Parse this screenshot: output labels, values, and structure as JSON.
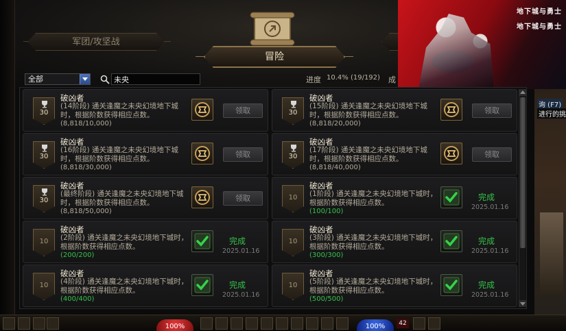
{
  "tabs": {
    "legion_label": "军团/攻坚战",
    "adventure_label": "冒险"
  },
  "filter": {
    "category_selected": "全部",
    "search_value": "未央"
  },
  "progress": {
    "label": "进度",
    "value": "10.4% (19/192)",
    "cut_label": "成"
  },
  "banner": {
    "logo_top": "地下城与勇士",
    "logo_bottom": "地下城与勇士"
  },
  "achievements": [
    {
      "title": "破凶者",
      "desc": "(14阶段) 通关逢魔之未央幻境地下城时，根据阶数获得相应点数。",
      "progress": "(8,818/10,000)",
      "points": "30",
      "status": "claim",
      "claim_label": "领取"
    },
    {
      "title": "破凶者",
      "desc": "(15阶段) 通关逢魔之未央幻境地下城时，根据阶数获得相应点数。",
      "progress": "(8,818/20,000)",
      "points": "30",
      "status": "claim",
      "claim_label": "领取"
    },
    {
      "title": "破凶者",
      "desc": "(16阶段) 通关逢魔之未央幻境地下城时，根据阶数获得相应点数。",
      "progress": "(8,818/30,000)",
      "points": "30",
      "status": "claim",
      "claim_label": "领取"
    },
    {
      "title": "破凶者",
      "desc": "(17阶段) 通关逢魔之未央幻境地下城时，根据阶数获得相应点数。",
      "progress": "(8,818/40,000)",
      "points": "30",
      "status": "claim",
      "claim_label": "领取"
    },
    {
      "title": "破凶者",
      "desc": "(最终阶段) 通关逢魔之未央幻境地下城时，根据阶数获得相应点数。",
      "progress": "(8,818/50,000)",
      "points": "30",
      "status": "claim",
      "claim_label": "领取"
    },
    {
      "title": "破凶者",
      "desc": "(1阶段) 通关逢魔之未央幻境地下城时，根据阶数获得相应点数。",
      "progress": "(100/100)",
      "points": "10",
      "status": "done",
      "done_label": "完成",
      "date": "2025.01.16"
    },
    {
      "title": "破凶者",
      "desc": "(2阶段) 通关逢魔之未央幻境地下城时，根据阶数获得相应点数。",
      "progress": "(200/200)",
      "points": "10",
      "status": "done",
      "done_label": "完成",
      "date": "2025.01.16"
    },
    {
      "title": "破凶者",
      "desc": "(3阶段) 通关逢魔之未央幻境地下城时，根据阶数获得相应点数。",
      "progress": "(300/300)",
      "points": "10",
      "status": "done",
      "done_label": "完成",
      "date": "2025.01.16"
    },
    {
      "title": "破凶者",
      "desc": "(4阶段) 通关逢魔之未央幻境地下城时，根据阶数获得相应点数。",
      "progress": "(400/400)",
      "points": "10",
      "status": "done",
      "done_label": "完成",
      "date": "2025.01.16"
    },
    {
      "title": "破凶者",
      "desc": "(5阶段) 通关逢魔之未央幻境地下城时，根据阶数获得相应点数。",
      "progress": "(500/500)",
      "points": "10",
      "status": "done",
      "done_label": "完成",
      "date": "2025.01.16"
    }
  ],
  "side": {
    "text1": "询 (F7)",
    "text2": "进行的挑"
  },
  "hud": {
    "hp": "100%",
    "mp": "100%",
    "level": "42"
  }
}
